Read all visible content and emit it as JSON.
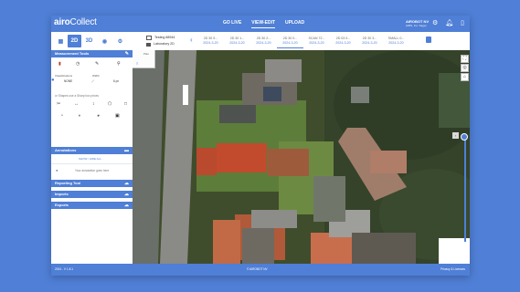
{
  "app": {
    "logo_bold": "airo",
    "logo_light": "Collect",
    "nav": [
      "GO LIVE",
      "VIEW-EDIT",
      "UPLOAD"
    ],
    "active_nav": "VIEW-EDIT",
    "org_name": "AIROBOT NV",
    "org_sub": "(HBS, Ins. Sage)"
  },
  "toolbar": {
    "mode_2d": "2D",
    "mode_3d": "3D",
    "layer_1": "Testing 88944",
    "layer_2": "Laboratory 2D",
    "dates": [
      {
        "label": "2D 30 9...",
        "date": "2024-3-20"
      },
      {
        "label": "2D 30 1...",
        "date": "2024-3-20"
      },
      {
        "label": "2D 30 2...",
        "date": "2024-3-20"
      },
      {
        "label": "2D 30 0...",
        "date": "2024-3-20"
      },
      {
        "label": "SCAN 72...",
        "date": "2024-3-20"
      },
      {
        "label": "2D 03 0...",
        "date": "2024-3-20"
      },
      {
        "label": "2D 30 3...",
        "date": "2024-3-20"
      },
      {
        "label": "SMALL 0...",
        "date": "2024-3-20"
      }
    ]
  },
  "sidebar": {
    "measurement_tools": "Measurement Tools",
    "classifications_label": "Classifications",
    "classification_value": "NONE",
    "width_label": "Width",
    "width_value": "6 px",
    "shapes_note": "or Shapes use a Sharp box prices",
    "annotations": "Annotations",
    "show_hide_all": "SHOW / HIDE ALL",
    "empty_annotations": "Your annotation goes here",
    "reporting_tool": "Reporting Tool",
    "imports": "Imports",
    "exports": "Exports"
  },
  "map": {
    "overlay_label": "Plan"
  },
  "footer": {
    "version": "2024 - V 1.8.1",
    "center": "© AIROBOT NV",
    "right": "Privacy & Licenses"
  }
}
